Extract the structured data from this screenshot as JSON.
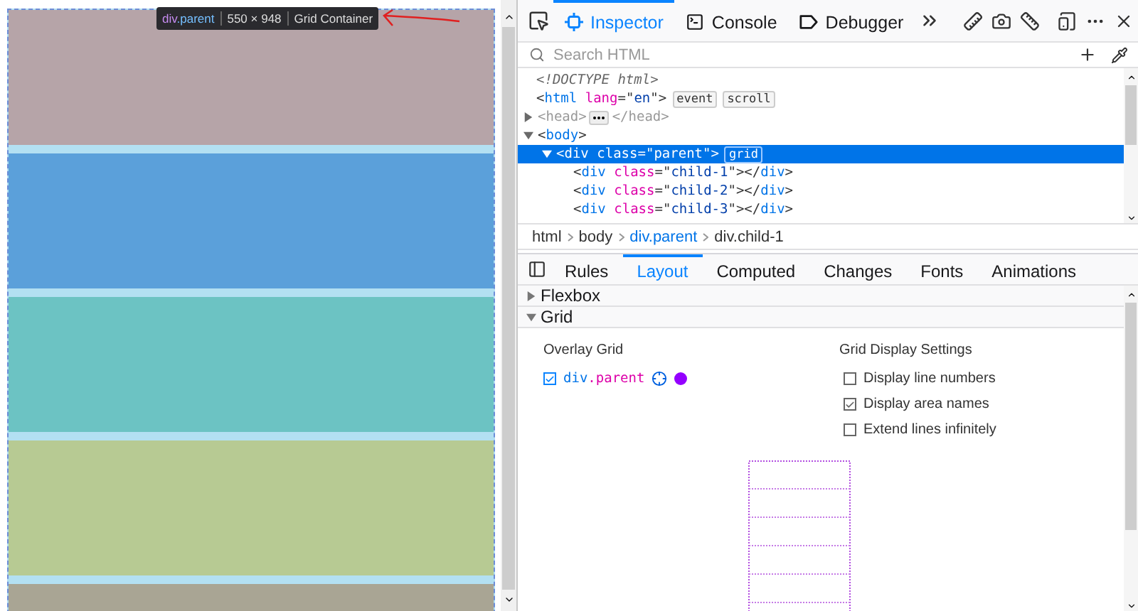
{
  "preview": {
    "grid_items": [
      {
        "color": "#b6a4a8"
      },
      {
        "color": "#5ba0da"
      },
      {
        "color": "#6cc3c3"
      },
      {
        "color": "#b7ca93"
      },
      {
        "color": "#a9a594"
      }
    ],
    "highlighter": {
      "tag": "div",
      "cls": ".parent",
      "size": "550 × 948",
      "kind": "Grid Container"
    }
  },
  "toolbar": {
    "tabs": [
      {
        "label": "Inspector",
        "kind": "inspector",
        "selected": true
      },
      {
        "label": "Console",
        "kind": "console",
        "selected": false
      },
      {
        "label": "Debugger",
        "kind": "debugger",
        "selected": false
      }
    ]
  },
  "search": {
    "placeholder": "Search HTML"
  },
  "markup": [
    {
      "parts": [
        {
          "doctype": "<!DOCTYPE html>"
        }
      ]
    },
    {
      "parts": [
        {
          "punct": "<"
        },
        {
          "tag": "html"
        },
        {
          "attr": " lang"
        },
        {
          "punct": "=\""
        },
        {
          "val": "en"
        },
        {
          "punct": "\">"
        }
      ],
      "badges": [
        "event",
        "scroll"
      ],
      "children": [
        {
          "parts": [
            {
              "dim": "<head>"
            },
            {
              "dim": "</head>"
            }
          ],
          "expanded": false
        },
        {
          "parts": [
            {
              "punct": "<"
            },
            {
              "tag": "body"
            },
            {
              "punct": ">"
            }
          ],
          "expanded": true,
          "children": [
            {
              "parts": [
                {
                  "punct": "<"
                },
                {
                  "tag": "div"
                },
                {
                  "attr": " class"
                },
                {
                  "punct": "=\""
                },
                {
                  "val": "parent"
                },
                {
                  "punct": "\">"
                }
              ],
              "badges": [
                "grid"
              ],
              "expanded": true,
              "selected": true,
              "children": [
                {
                  "parts": [
                    {
                      "punct": "<"
                    },
                    {
                      "tag": "div"
                    },
                    {
                      "attr": " class"
                    },
                    {
                      "punct": "=\""
                    },
                    {
                      "val": "child-1"
                    },
                    {
                      "punct": "\"></"
                    },
                    {
                      "tag": "div"
                    },
                    {
                      "punct": ">"
                    }
                  ],
                  "selected": false
                },
                {
                  "parts": [
                    {
                      "punct": "<"
                    },
                    {
                      "tag": "div"
                    },
                    {
                      "attr": " class"
                    },
                    {
                      "punct": "=\""
                    },
                    {
                      "val": "child-2"
                    },
                    {
                      "punct": "\"></"
                    },
                    {
                      "tag": "div"
                    },
                    {
                      "punct": ">"
                    }
                  ],
                  "selected": false
                },
                {
                  "parts": [
                    {
                      "punct": "<"
                    },
                    {
                      "tag": "div"
                    },
                    {
                      "attr": " class"
                    },
                    {
                      "punct": "=\""
                    },
                    {
                      "val": "child-3"
                    },
                    {
                      "punct": "\"></"
                    },
                    {
                      "tag": "div"
                    },
                    {
                      "punct": ">"
                    }
                  ],
                  "selected": false
                }
              ]
            }
          ]
        }
      ]
    }
  ],
  "breadcrumbs": [
    {
      "label": "html",
      "selected": false
    },
    {
      "label": "body",
      "selected": false
    },
    {
      "label": "div.parent",
      "selected": true
    },
    {
      "label": "div.child-1",
      "selected": false
    }
  ],
  "sidebar_tabs": [
    {
      "label": "Rules",
      "selected": false
    },
    {
      "label": "Layout",
      "selected": true
    },
    {
      "label": "Computed",
      "selected": false
    },
    {
      "label": "Changes",
      "selected": false
    },
    {
      "label": "Fonts",
      "selected": false
    },
    {
      "label": "Animations",
      "selected": false
    }
  ],
  "sections": [
    {
      "label": "Flexbox",
      "expanded": false
    },
    {
      "label": "Grid",
      "expanded": true
    }
  ],
  "overlay_grid": {
    "heading": "Overlay Grid",
    "items": [
      {
        "checked": true,
        "tag": "div",
        "cls": ".parent",
        "color": "#9400ff"
      }
    ]
  },
  "grid_settings": {
    "heading": "Grid Display Settings",
    "options": [
      {
        "label": "Display line numbers",
        "checked": false
      },
      {
        "label": "Display area names",
        "checked": true
      },
      {
        "label": "Extend lines infinitely",
        "checked": false
      }
    ]
  }
}
